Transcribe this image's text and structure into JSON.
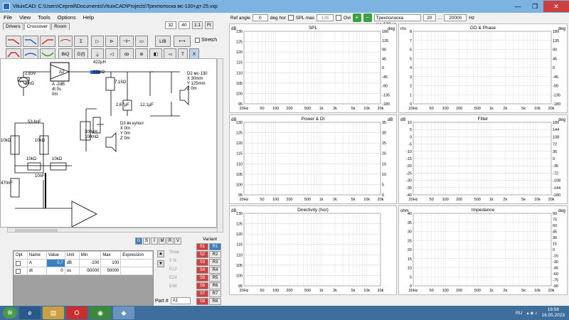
{
  "window": {
    "title": "VituixCAD: C:\\Users\\Сергей\\Documents\\VituixCAD\\Projects\\Трехполоска мс-130+дт-25.vxp",
    "minimize": "—",
    "maximize": "❐",
    "close": "✕"
  },
  "menu": [
    "File",
    "View",
    "Tools",
    "Options",
    "Help"
  ],
  "tabs": [
    "Drivers",
    "Crossover",
    "Room"
  ],
  "top_fields": {
    "f1": "32",
    "f2": "40",
    "btn1": "1:1",
    "btn2": "Ft"
  },
  "toolbar": {
    "biq": "BiQ",
    "gf": "G(f)",
    "lib": "LIB",
    "stretch": "Stretch",
    "t": "T",
    "x": "X"
  },
  "circuit_labels": {
    "gen": "2,83V\n\n1mΩ",
    "amp": "A2",
    "amp_params": "A -2dB\ndt 0s\n0m",
    "l1": "422µH\n\n69mΩ",
    "r1": "7,15Ω",
    "c1": "2,67µF",
    "c2": "12,1µF",
    "d2": "D2 мс-130\nX 30mm\nY 125mm\nZ 0m",
    "r2": "300µH\n100mΩ",
    "d3": "D3 вч купол\nX 0m\nY 0m\nZ 0m",
    "c3": "53,6nF",
    "r3": "10kΩ",
    "r4": "10kΩ",
    "c4": "470nF",
    "r5": "10kΩ",
    "c5": "10nF",
    "r6": "10kΩ"
  },
  "objbar": [
    "O",
    "S",
    "I",
    "M",
    "R",
    "V"
  ],
  "params": {
    "headers": [
      "Opt",
      "Name",
      "Value",
      "Unit",
      "Min",
      "Max",
      "Expression"
    ],
    "rows": [
      {
        "name": "A",
        "value": "0,7",
        "unit": "dB",
        "min": "-100",
        "max": "100",
        "expr": ""
      },
      {
        "name": "dt",
        "value": "0",
        "unit": "us",
        "min": "-50000",
        "max": "50000",
        "expr": ""
      }
    ]
  },
  "snap": {
    "title": "Snap",
    "options": [
      "5 %",
      "E12",
      "E24",
      "E48"
    ]
  },
  "variant": {
    "title": "Variant",
    "buttons": [
      "S1",
      "R1",
      "S2",
      "R2",
      "S3",
      "R3",
      "S4",
      "R4",
      "S5",
      "R5",
      "S6",
      "R6",
      "S7",
      "R7",
      "S8",
      "R8"
    ]
  },
  "part": {
    "label": "Part #",
    "value": "A1"
  },
  "right_top": {
    "ref_angle_label": "Ref angle",
    "ref_angle": "0",
    "deg_hor": "deg hor",
    "spl_max_label": "SPL max",
    "spl_max": "135",
    "ovl": "Ovl",
    "driver": "Трехполоска мс-130+д",
    "f_from": "20",
    "f_to": "20000",
    "hz": "Hz"
  },
  "charts": [
    {
      "title": "SPL",
      "ylabel": "dB",
      "y2label": "deg",
      "yticks": [
        "130",
        "125",
        "120",
        "115",
        "110",
        "105",
        "100",
        "95"
      ],
      "y2ticks": [
        "180",
        "135",
        "90",
        "45",
        "0",
        "-45",
        "-90",
        "-135",
        "-180"
      ]
    },
    {
      "title": "GD & Phase",
      "ylabel": "ms",
      "y2label": "deg",
      "yticks": [
        "8",
        "7",
        "6",
        "5",
        "4",
        "3",
        "2",
        "1",
        "0"
      ],
      "y2ticks": [
        "180",
        "135",
        "90",
        "45",
        "0",
        "-45",
        "-90",
        "-135",
        "-180"
      ]
    },
    {
      "title": "Power & DI",
      "ylabel": "dB",
      "y2label": "dB",
      "yticks": [
        "130",
        "125",
        "120",
        "115",
        "110",
        "105",
        "100",
        "95"
      ],
      "y2ticks": [
        "35",
        "30",
        "25",
        "20",
        "15",
        "10",
        "5",
        "0"
      ]
    },
    {
      "title": "Filter",
      "ylabel": "dB",
      "y2label": "deg",
      "yticks": [
        "10",
        "5",
        "0",
        "-5",
        "-10",
        "-15",
        "-20",
        "-25",
        "-30",
        "-35",
        "-40"
      ],
      "y2ticks": [
        "180",
        "144",
        "108",
        "72",
        "36",
        "0",
        "-36",
        "-72",
        "-108",
        "-144",
        "-180"
      ]
    },
    {
      "title": "Directivity (hor)",
      "ylabel": "dB",
      "y2label": "",
      "yticks": [
        "130",
        "125",
        "120",
        "115",
        "110",
        "105",
        "100",
        "95"
      ],
      "y2ticks": []
    },
    {
      "title": "Impedance",
      "ylabel": "ohm",
      "y2label": "deg",
      "yticks": [
        "40",
        "35",
        "30",
        "25",
        "20",
        "15",
        "10",
        "5",
        "0"
      ],
      "y2ticks": [
        "90",
        "75",
        "60",
        "45",
        "30",
        "15",
        "0",
        "-15",
        "-30",
        "-45",
        "-60",
        "-75",
        "-90"
      ]
    }
  ],
  "xticks": [
    "20Hz",
    "50",
    "100",
    "200",
    "500",
    "1k",
    "2k",
    "5k",
    "10k",
    "20k"
  ],
  "taskbar": {
    "lang": "RU",
    "time": "18:58",
    "date": "16.05.2023"
  }
}
